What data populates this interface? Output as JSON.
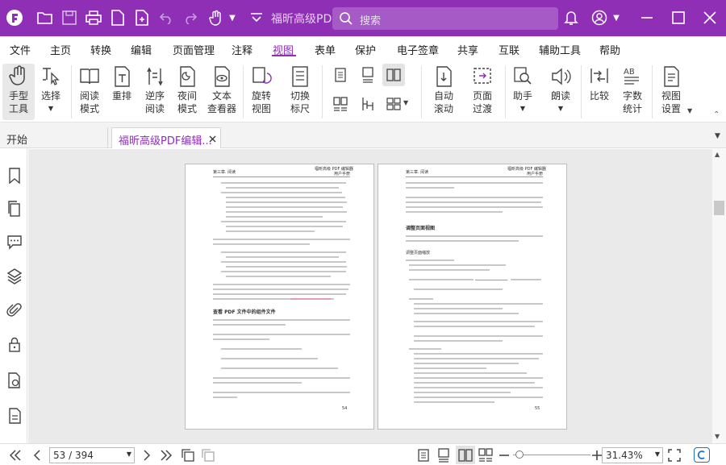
{
  "titlebar": {
    "title": "福昕高级PD...",
    "search_placeholder": "搜索"
  },
  "menu": {
    "items": [
      "文件",
      "主页",
      "转换",
      "编辑",
      "页面管理",
      "注释",
      "视图",
      "表单",
      "保护",
      "电子签章",
      "共享",
      "互联",
      "辅助工具",
      "帮助"
    ],
    "active": "视图"
  },
  "ribbon": {
    "hand_tool": "手型\n工具",
    "select": "选择",
    "read_mode": "阅读\n模式",
    "reflow": "重排",
    "reverse_read": "逆序\n阅读",
    "night_mode": "夜间\n模式",
    "text_viewer": "文本\n查看器",
    "rotate_view": "旋转\n视图",
    "toggle_ruler": "切换\n标尺",
    "auto_scroll": "自动\n滚动",
    "page_transition": "页面\n过渡",
    "assistant": "助手",
    "read_aloud": "朗读",
    "compare": "比较",
    "word_count": "字数\n统计",
    "view_settings": "视图\n设置"
  },
  "tabs": {
    "home": "开始",
    "document": "福昕高级PDF编辑..."
  },
  "pages": {
    "left_header_left": "第三章. 阅读",
    "left_header_right": "福昕高级 PDF 编辑器",
    "left_header_right2": "用户手册",
    "left_section": "查看 PDF 文件中的组件文件",
    "left_page_num": "54",
    "right_header_left": "第三章. 阅读",
    "right_header_right": "福昕高级 PDF 编辑器",
    "right_header_right2": "用户手册",
    "right_section": "调整页面视图",
    "right_subsection": "调整页面缩放",
    "right_page_num": "55"
  },
  "status": {
    "page_value": "53 / 394",
    "zoom_value": "31.43%"
  },
  "colors": {
    "brand": "#8e2fb5"
  }
}
